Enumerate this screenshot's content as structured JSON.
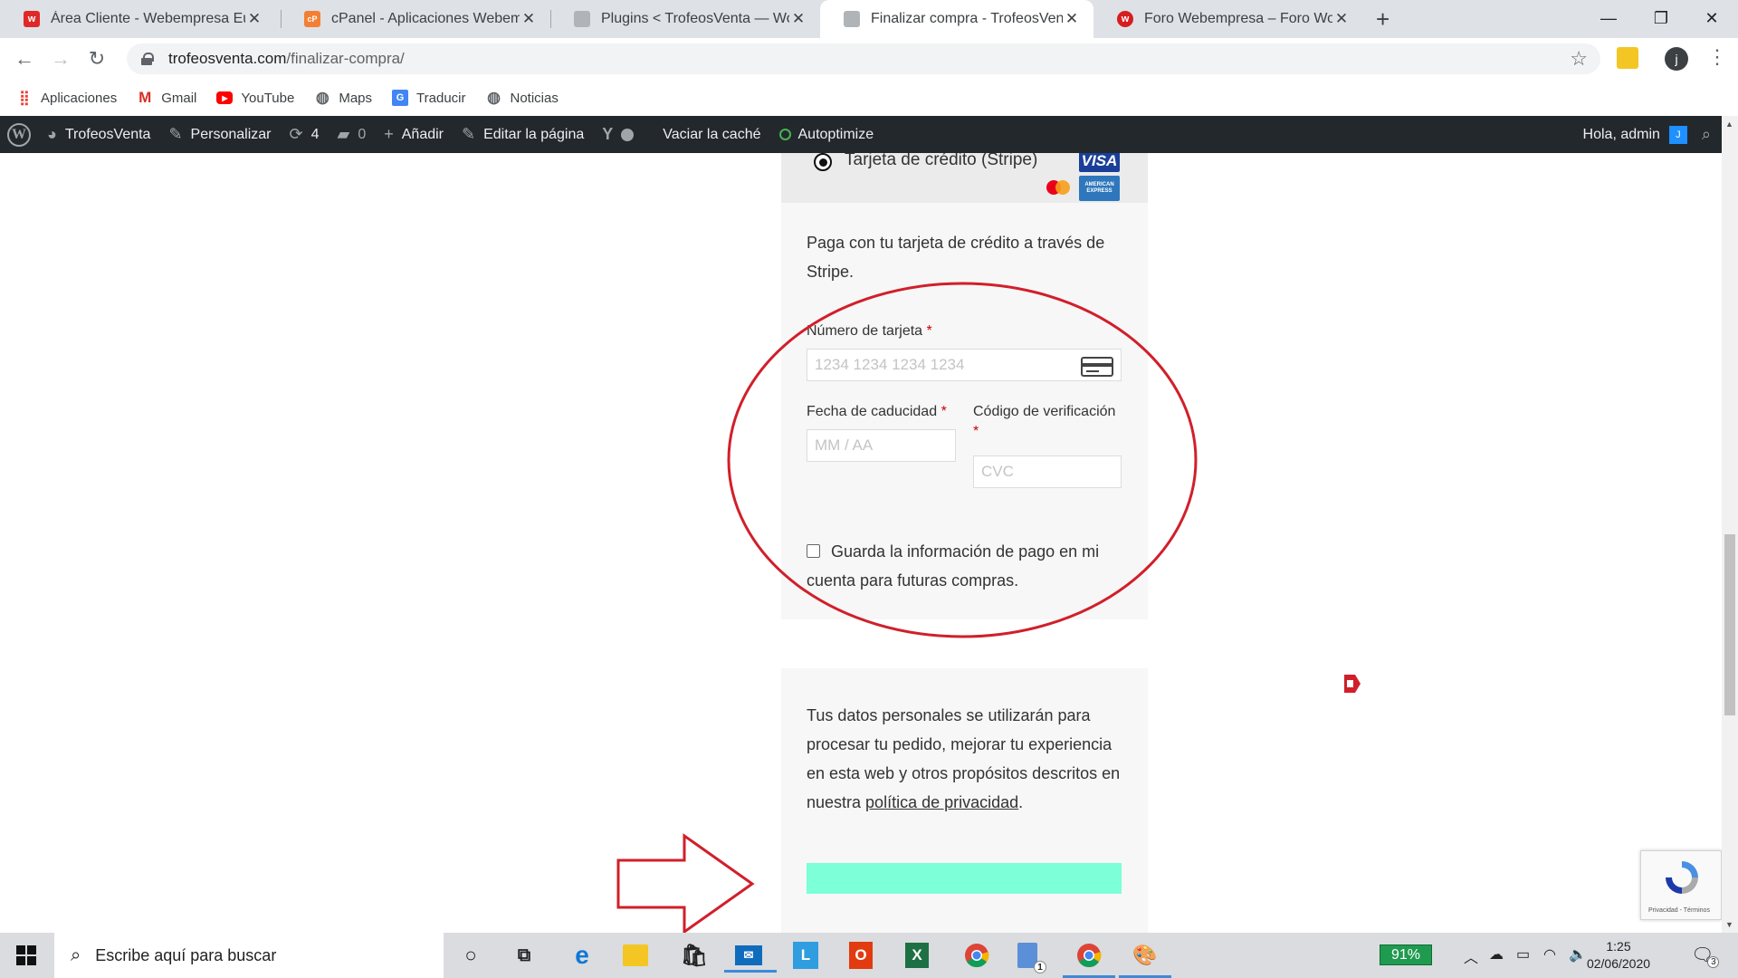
{
  "browser": {
    "tabs": [
      {
        "title": "Área Cliente - Webempresa Europa",
        "favicon_color": "#e02828",
        "favicon_glyph": "w",
        "active": false
      },
      {
        "title": "cPanel - Aplicaciones Webempresa",
        "favicon_color": "#f37f35",
        "favicon_glyph": "cP",
        "active": false
      },
      {
        "title": "Plugins < TrofeosVenta — WordPress",
        "favicon_color": "#9aa0a6",
        "favicon_glyph": "",
        "active": false
      },
      {
        "title": "Finalizar compra - TrofeosVenta",
        "favicon_color": "#9aa0a6",
        "favicon_glyph": "",
        "active": true
      },
      {
        "title": "Foro Webempresa – Foro WordPress",
        "favicon_color": "#d61e1e",
        "favicon_glyph": "w",
        "active": false
      }
    ],
    "url_host": "trofeosventa.com",
    "url_path": "/finalizar-compra/",
    "profile_initial": "j",
    "bookmarks": [
      {
        "label": "Aplicaciones",
        "icon": "apps-grid-icon",
        "color": "#ea4335"
      },
      {
        "label": "Gmail",
        "icon": "gmail-icon",
        "color": "#d93025"
      },
      {
        "label": "YouTube",
        "icon": "youtube-icon",
        "color": "#ff0000"
      },
      {
        "label": "Maps",
        "icon": "globe-icon",
        "color": "#5f6368"
      },
      {
        "label": "Traducir",
        "icon": "translate-icon",
        "color": "#4285f4"
      },
      {
        "label": "Noticias",
        "icon": "globe-icon",
        "color": "#5f6368"
      }
    ]
  },
  "adminbar": {
    "site_name": "TrofeosVenta",
    "customize": "Personalizar",
    "updates_count": "4",
    "comments_count": "0",
    "add_new": "Añadir",
    "edit_page": "Editar la página",
    "clear_cache": "Vaciar la caché",
    "autoptimize": "Autoptimize",
    "greeting": "Hola, admin",
    "admin_initial": "J"
  },
  "checkout": {
    "payment_method_label": "Tarjeta de crédito (Stripe)",
    "card_logos": [
      "VISA",
      "mastercard",
      "AMERICAN EXPRESS"
    ],
    "description": "Paga con tu tarjeta de crédito a través de Stripe.",
    "card_number_label": "Número de tarjeta",
    "card_number_placeholder": "1234 1234 1234 1234",
    "expiry_label": "Fecha de caducidad",
    "expiry_placeholder": "MM / AA",
    "cvc_label": "Código de verificación",
    "cvc_placeholder": "CVC",
    "required_mark": "*",
    "save_payment_label": "Guarda la información de pago en mi cuenta para futuras compras.",
    "privacy_text_before": "Tus datos personales se utilizarán para procesar tu pedido, mejorar tu experiencia en esta web y otros propósitos descritos en nuestra ",
    "privacy_link": "política de privacidad",
    "privacy_text_after": ".",
    "order_button_color": "#7dffd7",
    "recaptcha_text": "Privacidad - Términos"
  },
  "annotation_color": "#d11f2a",
  "taskbar": {
    "search_placeholder": "Escribe aquí para buscar",
    "battery": "91%",
    "time": "1:25",
    "date": "02/06/2020",
    "notifications": "3",
    "task_view_badge": "1"
  }
}
